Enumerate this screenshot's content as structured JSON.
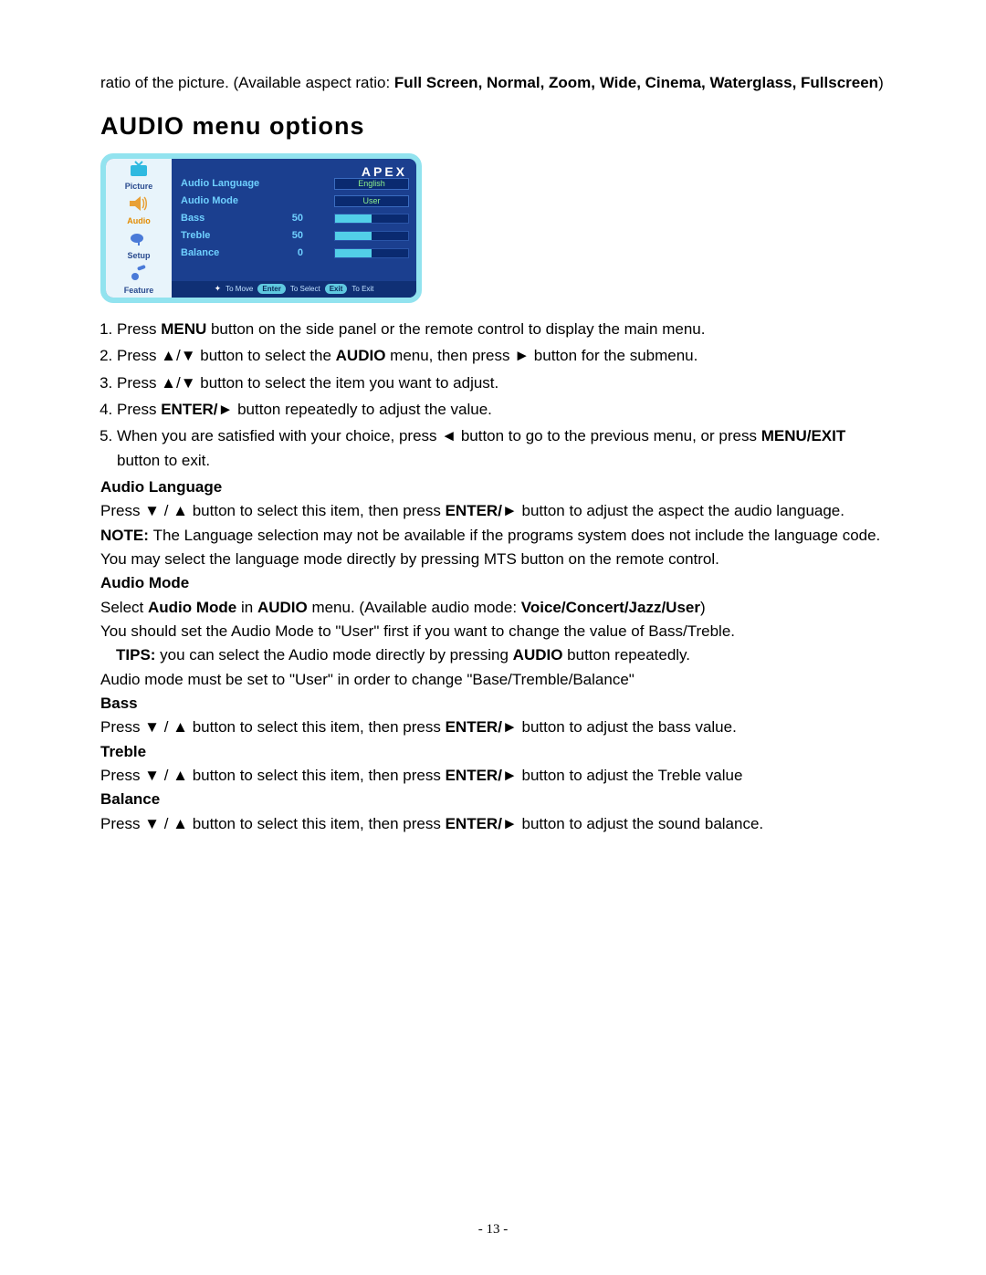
{
  "intro_line_pre": "ratio of the picture. (Available aspect ratio: ",
  "intro_bold": "Full Screen, Normal, Zoom, Wide, Cinema, Waterglass, Fullscreen",
  "intro_line_post": ")",
  "heading": "AUDIO menu options",
  "osd": {
    "brand": "APEX",
    "tabs": [
      {
        "label": "Picture"
      },
      {
        "label": "Audio"
      },
      {
        "label": "Setup"
      },
      {
        "label": "Feature"
      }
    ],
    "items": {
      "audio_language": {
        "label": "Audio Language",
        "value": "English"
      },
      "audio_mode": {
        "label": "Audio Mode",
        "value": "User"
      },
      "bass": {
        "label": "Bass",
        "value": "50",
        "pct": 50
      },
      "treble": {
        "label": "Treble",
        "value": "50",
        "pct": 50
      },
      "balance": {
        "label": "Balance",
        "value": "0",
        "pct": 50
      }
    },
    "footer": {
      "move": "To Move",
      "enter": "Enter",
      "select": "To Select",
      "exit": "Exit",
      "toexit": "To Exit"
    }
  },
  "steps": {
    "s1_a": "Press ",
    "s1_b": "MENU",
    "s1_c": " button on the side panel or the remote control to display the main menu.",
    "s2_a": "Press ▲/▼ button to select the ",
    "s2_b": "AUDIO",
    "s2_c": " menu, then press ► button for the submenu.",
    "s3": "Press ▲/▼ button to select the item you want to adjust.",
    "s4_a": "Press ",
    "s4_b": "ENTER/►",
    "s4_c": " button repeatedly to adjust the value.",
    "s5_a": "When you are satisfied with your choice, press ◄ button to go to the previous menu, or press ",
    "s5_b": "MENU/EXIT",
    "s5_c": " button to exit."
  },
  "audio_language": {
    "title": "Audio Language",
    "line1_a": "Press ▼ / ▲ button to select this item, then press ",
    "line1_b": "ENTER/►",
    "line1_c": " button to adjust the aspect the audio language.",
    "note_a": "NOTE: ",
    "note_b": "The Language selection may not be available if the programs system does not include the language code. You may select the language mode directly by pressing MTS button on the remote control."
  },
  "audio_mode": {
    "title": "Audio Mode",
    "line1_a": "Select ",
    "line1_b": "Audio Mode",
    "line1_c": " in ",
    "line1_d": "AUDIO",
    "line1_e": " menu. (Available audio mode: ",
    "line1_f": "Voice/Concert/Jazz/User",
    "line1_g": ")",
    "line2": "You should set the Audio Mode to \"User\" first if you want to change the value of Bass/Treble.",
    "tips_a": "TIPS: ",
    "tips_b": "you can select the Audio mode directly by pressing ",
    "tips_c": "AUDIO",
    "tips_d": " button repeatedly.",
    "line3": "Audio mode must be set to \"User\" in order to change \"Base/Tremble/Balance\""
  },
  "bass": {
    "title": "Bass",
    "line_a": "Press ▼ / ▲ button to select this item, then press ",
    "line_b": "ENTER/►",
    "line_c": " button to adjust the bass value."
  },
  "treble": {
    "title": "Treble",
    "line_a": "Press ▼ / ▲ button to select this item, then press ",
    "line_b": "ENTER/►",
    "line_c": " button to adjust the Treble value"
  },
  "balance": {
    "title": "Balance",
    "line_a": "Press ▼ / ▲ button to select this item, then press ",
    "line_b": "ENTER/►",
    "line_c": " button to adjust the sound balance."
  },
  "page_number": "- 13 -"
}
